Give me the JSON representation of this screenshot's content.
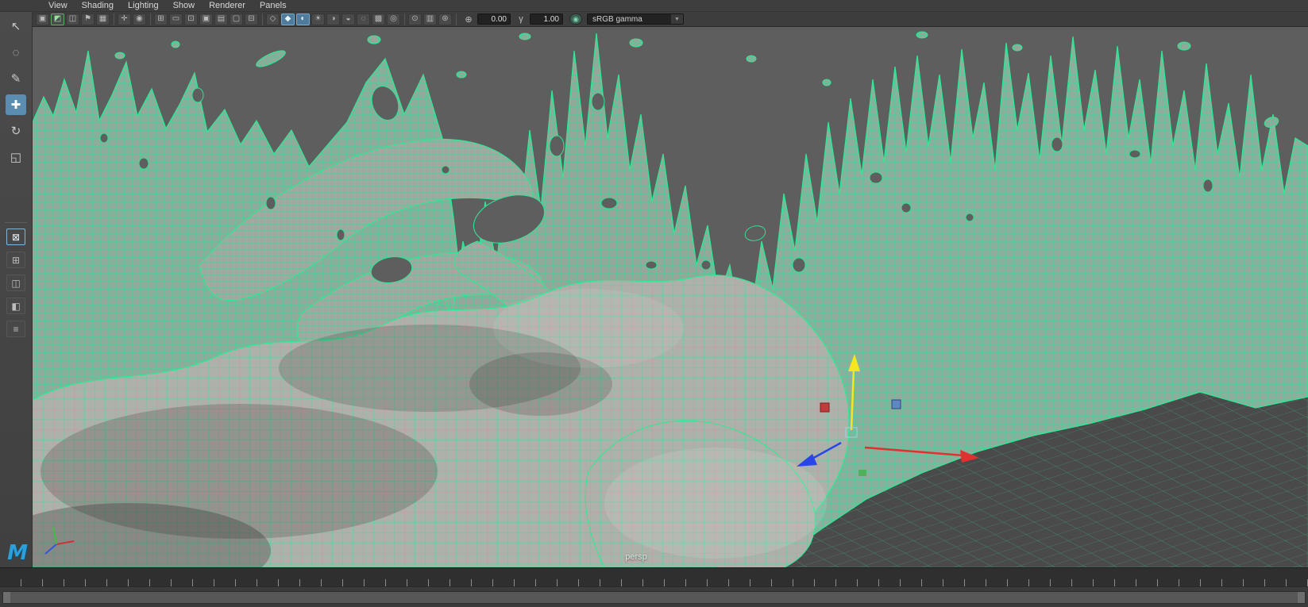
{
  "panel_menu": {
    "items": [
      "View",
      "Shading",
      "Lighting",
      "Show",
      "Renderer",
      "Panels"
    ]
  },
  "toolbar": {
    "icons": [
      {
        "name": "select-camera-icon",
        "glyph": "▣"
      },
      {
        "name": "camera-lock-icon",
        "glyph": "◩",
        "green": true
      },
      {
        "name": "camera-attributes-icon",
        "glyph": "◫"
      },
      {
        "name": "bookmark-icon",
        "glyph": "⚑"
      },
      {
        "name": "image-plane-icon",
        "glyph": "▦"
      },
      {
        "sep": true
      },
      {
        "name": "pan-zoom-icon",
        "glyph": "✛"
      },
      {
        "name": "oversampling-icon",
        "glyph": "◉"
      },
      {
        "sep": true
      },
      {
        "name": "grid-icon",
        "glyph": "⊞"
      },
      {
        "name": "film-gate-icon",
        "glyph": "▭"
      },
      {
        "name": "resolution-gate-icon",
        "glyph": "⊡"
      },
      {
        "name": "gate-mask-icon",
        "glyph": "▣"
      },
      {
        "name": "field-chart-icon",
        "glyph": "▤"
      },
      {
        "name": "safe-action-icon",
        "glyph": "▢"
      },
      {
        "name": "safe-title-icon",
        "glyph": "⊟"
      },
      {
        "sep": true
      },
      {
        "name": "wireframe-icon",
        "glyph": "◇"
      },
      {
        "name": "shaded-icon",
        "glyph": "◆",
        "active": true
      },
      {
        "name": "textured-icon",
        "glyph": "◐",
        "active": true
      },
      {
        "name": "use-all-lights-icon",
        "glyph": "☀"
      },
      {
        "name": "shadows-icon",
        "glyph": "◑"
      },
      {
        "name": "ambient-occlusion-icon",
        "glyph": "◒"
      },
      {
        "name": "motion-blur-icon",
        "glyph": "◌"
      },
      {
        "name": "antialias-icon",
        "glyph": "▩"
      },
      {
        "name": "depth-of-field-icon",
        "glyph": "◎"
      },
      {
        "sep": true
      },
      {
        "name": "isolate-select-icon",
        "glyph": "⊙"
      },
      {
        "name": "xray-icon",
        "glyph": "▥"
      },
      {
        "name": "wireframe-on-shaded-icon",
        "glyph": "⊛"
      },
      {
        "sep": true
      }
    ],
    "exposure_glyph": "⊕",
    "exposure_value": "0.00",
    "gamma_glyph": "γ",
    "gamma_value": "1.00",
    "color_mgmt_glyph": "◉",
    "view_transform": "sRGB gamma",
    "dropdown_arrow": "▼"
  },
  "toolbox": {
    "tools": [
      {
        "name": "select-tool",
        "glyph": "↖"
      },
      {
        "name": "lasso-select-tool",
        "glyph": "◌"
      },
      {
        "name": "paint-select-tool",
        "glyph": "✎"
      },
      {
        "name": "move-tool",
        "glyph": "✚",
        "active": true
      },
      {
        "name": "rotate-tool",
        "glyph": "↻"
      },
      {
        "name": "scale-tool",
        "glyph": "◱"
      }
    ],
    "layouts": [
      {
        "name": "single-pane-layout-button",
        "glyph": "⊠",
        "active": true
      },
      {
        "name": "four-pane-layout-button",
        "glyph": "⊞"
      },
      {
        "name": "two-pane-layout-button",
        "glyph": "◫"
      },
      {
        "name": "persp-outliner-layout-button",
        "glyph": "◧"
      },
      {
        "name": "layout-menu-button",
        "glyph": "≡"
      }
    ]
  },
  "viewport": {
    "camera_label": "persp"
  },
  "logo": {
    "glyph": "M"
  },
  "colors": {
    "wireframe_green": "#2fe894",
    "selection_blue": "#5b8db0",
    "viewport_bg": "#5e5e5e",
    "manipulator_x": "#e03030",
    "manipulator_y": "#f5e61e",
    "manipulator_z": "#2b46e8"
  }
}
